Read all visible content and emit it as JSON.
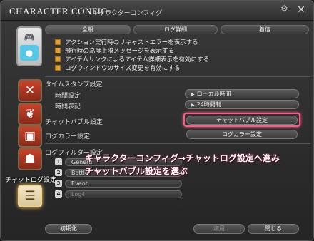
{
  "window": {
    "title": "CHARACTER CONFIG",
    "subtitle": "キャラクターコンフィグ"
  },
  "tabs": [
    {
      "label": "全般"
    },
    {
      "label": "ログ詳細"
    },
    {
      "label": "着信"
    }
  ],
  "options": [
    {
      "label": "アクション実行時のリキャストエラーを表示する",
      "checked": true
    },
    {
      "label": "飛行時の高度上限メッセージを表示する",
      "checked": true
    },
    {
      "label": "アイテムリンクによるアイテム詳細表示を有効にする",
      "checked": true
    },
    {
      "label": "ログウィンドウのサイズ変更を有効にする",
      "checked": true
    }
  ],
  "timestamp": {
    "section_title": "タイムスタンプ設定",
    "time_setting_label": "時間設定",
    "time_setting_value": "ローカル時間",
    "time_format_label": "時間表記",
    "time_format_value": "24時間制"
  },
  "chat_bubble": {
    "label": "チャットバブル設定",
    "button": "チャットバブル設定"
  },
  "log_color": {
    "label": "ログカラー設定",
    "button": "ログカラー設定"
  },
  "log_filter": {
    "section_title": "ログフィルター設定",
    "items": [
      {
        "num": "1",
        "name": "General"
      },
      {
        "num": "2",
        "name": "Battle"
      },
      {
        "num": "3",
        "name": "Event"
      },
      {
        "num": "4",
        "name": "Log4"
      }
    ]
  },
  "side_caption": "チャットログ設定",
  "overlay_text": {
    "line1": "キャラクターコンフィグ→チャットログ設定へ進み",
    "line2": "チャットバブル設定を選ぶ"
  },
  "footer": {
    "reset": "初期化",
    "apply": "適用",
    "close": "閉じる"
  },
  "colors": {
    "highlight": "#ff5a8a",
    "checkbox": "#e0a030"
  }
}
